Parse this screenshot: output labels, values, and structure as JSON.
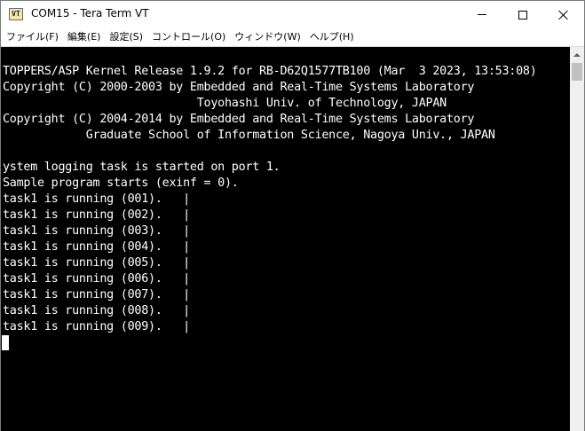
{
  "titlebar": {
    "icon_text": "VT",
    "title": "COM15 - Tera Term VT"
  },
  "menu": {
    "items": [
      {
        "label": "ファイル(F)"
      },
      {
        "label": "編集(E)"
      },
      {
        "label": "設定(S)"
      },
      {
        "label": "コントロール(O)"
      },
      {
        "label": "ウィンドウ(W)"
      },
      {
        "label": "ヘルプ(H)"
      }
    ]
  },
  "terminal": {
    "lines": [
      "TOPPERS/ASP Kernel Release 1.9.2 for RB-D62Q1577TB100 (Mar  3 2023, 13:53:08)",
      "Copyright (C) 2000-2003 by Embedded and Real-Time Systems Laboratory",
      "                            Toyohashi Univ. of Technology, JAPAN",
      "Copyright (C) 2004-2014 by Embedded and Real-Time Systems Laboratory",
      "            Graduate School of Information Science, Nagoya Univ., JAPAN",
      "",
      "ystem logging task is started on port 1.",
      "Sample program starts (exinf = 0).",
      "task1 is running (001).   |",
      "task1 is running (002).   |",
      "task1 is running (003).   |",
      "task1 is running (004).   |",
      "task1 is running (005).   |",
      "task1 is running (006).   |",
      "task1 is running (007).   |",
      "task1 is running (008).   |",
      "task1 is running (009).   |"
    ]
  },
  "colors": {
    "terminal_bg": "#000000",
    "terminal_fg": "#ffffff"
  }
}
